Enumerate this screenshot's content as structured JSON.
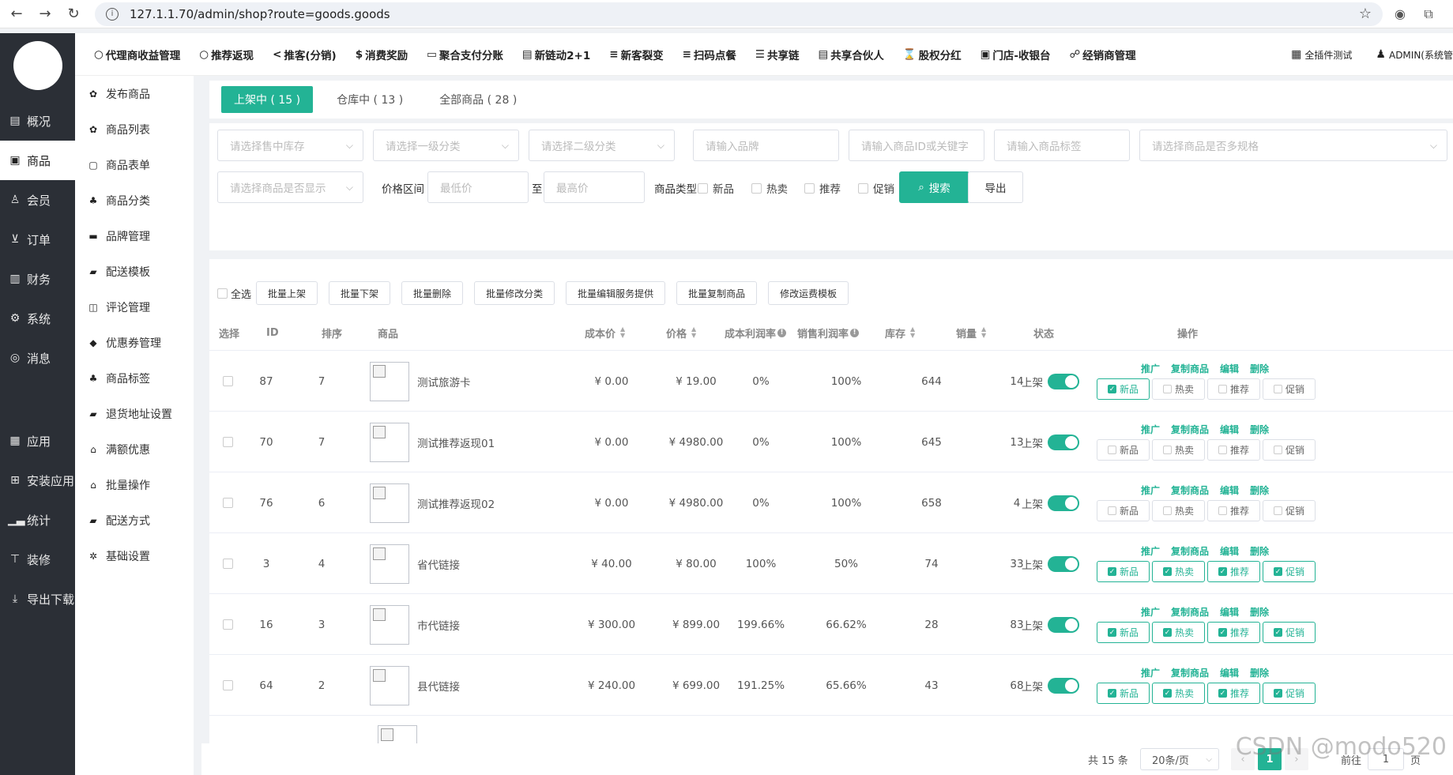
{
  "browser": {
    "url": "127.1.1.70/admin/shop?route=goods.goods"
  },
  "left_nav": [
    {
      "label": "概况",
      "icon": "dashboard-icon",
      "glyph": "▤"
    },
    {
      "label": "商品",
      "icon": "goods-icon",
      "glyph": "▣",
      "active": true
    },
    {
      "label": "会员",
      "icon": "member-icon",
      "glyph": "♙"
    },
    {
      "label": "订单",
      "icon": "cart-icon",
      "glyph": "⊻"
    },
    {
      "label": "财务",
      "icon": "finance-icon",
      "glyph": "▥"
    },
    {
      "label": "系统",
      "icon": "settings-icon",
      "glyph": "⚙"
    },
    {
      "label": "消息",
      "icon": "message-icon",
      "glyph": "◎"
    },
    {
      "label": "应用",
      "icon": "apps-icon",
      "glyph": "▦",
      "gap_before": true
    },
    {
      "label": "安装应用",
      "icon": "install-icon",
      "glyph": "⊞"
    },
    {
      "label": "统计",
      "icon": "stats-icon",
      "glyph": "▁▃"
    },
    {
      "label": "装修",
      "icon": "decorate-icon",
      "glyph": "⊤"
    },
    {
      "label": "导出下载",
      "icon": "download-icon",
      "glyph": "⤓"
    }
  ],
  "top_nav": [
    {
      "label": "代理商收益管理",
      "glyph": "○"
    },
    {
      "label": "推荐返现",
      "glyph": "○"
    },
    {
      "label": "推客(分销)",
      "glyph": "<"
    },
    {
      "label": "消费奖励",
      "glyph": "$"
    },
    {
      "label": "聚合支付分账",
      "glyph": "▭"
    },
    {
      "label": "新链动2+1",
      "glyph": "▤"
    },
    {
      "label": "新客裂变",
      "glyph": "≡"
    },
    {
      "label": "扫码点餐",
      "glyph": "≡"
    },
    {
      "label": "共享链",
      "glyph": "☰"
    },
    {
      "label": "共享合伙人",
      "glyph": "▤"
    },
    {
      "label": "股权分红",
      "glyph": "⌛"
    },
    {
      "label": "门店-收银台",
      "glyph": "▣"
    },
    {
      "label": "经销商管理",
      "glyph": "☍"
    }
  ],
  "top_right": {
    "plugin": "全插件测试",
    "user": "ADMIN(系统管"
  },
  "sub_nav": [
    {
      "label": "发布商品",
      "glyph": "✿"
    },
    {
      "label": "商品列表",
      "glyph": "✿"
    },
    {
      "label": "商品表单",
      "glyph": "▢"
    },
    {
      "label": "商品分类",
      "glyph": "♣"
    },
    {
      "label": "品牌管理",
      "glyph": "▬"
    },
    {
      "label": "配送模板",
      "glyph": "▰"
    },
    {
      "label": "评论管理",
      "glyph": "◫"
    },
    {
      "label": "优惠券管理",
      "glyph": "◆"
    },
    {
      "label": "商品标签",
      "glyph": "♣"
    },
    {
      "label": "退货地址设置",
      "glyph": "▰"
    },
    {
      "label": "满额优惠",
      "glyph": "⌂"
    },
    {
      "label": "批量操作",
      "glyph": "⌂"
    },
    {
      "label": "配送方式",
      "glyph": "▰"
    },
    {
      "label": "基础设置",
      "glyph": "✲"
    }
  ],
  "tabs": [
    {
      "label": "上架中 ( 15 )",
      "active": true
    },
    {
      "label": "仓库中 ( 13 )"
    },
    {
      "label": "全部商品 ( 28 )"
    }
  ],
  "filters": {
    "stock": "请选择售中库存",
    "cat1": "请选择一级分类",
    "cat2": "请选择二级分类",
    "brand": "请输入品牌",
    "keyword": "请输入商品ID或关键字",
    "tag": "请输入商品标签",
    "multi_spec": "请选择商品是否多规格",
    "display": "请选择商品是否显示",
    "price_label": "价格区间",
    "min_price": "最低价",
    "to": "至",
    "max_price": "最高价",
    "type_label": "商品类型",
    "types": [
      "新品",
      "热卖",
      "推荐",
      "促销"
    ],
    "search": "搜索",
    "export": "导出"
  },
  "bulk": {
    "select_all": "全选",
    "buttons": [
      "批量上架",
      "批量下架",
      "批量删除",
      "批量修改分类",
      "批量编辑服务提供",
      "批量复制商品",
      "修改运费模板"
    ]
  },
  "columns": {
    "select": "选择",
    "id": "ID",
    "sort": "排序",
    "goods": "商品",
    "cost": "成本价",
    "price": "价格",
    "cost_margin": "成本利润率",
    "sale_margin": "销售利润率",
    "stock": "库存",
    "sales": "销量",
    "status": "状态",
    "ops": "操作"
  },
  "op_links": [
    "推广",
    "复制商品",
    "编辑",
    "删除"
  ],
  "op_tags": [
    "新品",
    "热卖",
    "推荐",
    "促销"
  ],
  "rows": [
    {
      "id": "87",
      "sort": "7",
      "name": "测试旅游卡",
      "cost": "¥ 0.00",
      "price": "¥ 19.00",
      "cm": "0%",
      "sm": "100%",
      "stock": "644",
      "sales": "14",
      "status": "上架",
      "tags": [
        true,
        false,
        false,
        false
      ]
    },
    {
      "id": "70",
      "sort": "7",
      "name": "测试推荐返现01",
      "cost": "¥ 0.00",
      "price": "¥ 4980.00",
      "cm": "0%",
      "sm": "100%",
      "stock": "645",
      "sales": "13",
      "status": "上架",
      "tags": [
        false,
        false,
        false,
        false
      ]
    },
    {
      "id": "76",
      "sort": "6",
      "name": "测试推荐返现02",
      "cost": "¥ 0.00",
      "price": "¥ 4980.00",
      "cm": "0%",
      "sm": "100%",
      "stock": "658",
      "sales": "4",
      "status": "上架",
      "tags": [
        false,
        false,
        false,
        false
      ]
    },
    {
      "id": "3",
      "sort": "4",
      "name": "省代链接",
      "cost": "¥ 40.00",
      "price": "¥ 80.00",
      "cm": "100%",
      "sm": "50%",
      "stock": "74",
      "sales": "33",
      "status": "上架",
      "tags": [
        true,
        true,
        true,
        true
      ]
    },
    {
      "id": "16",
      "sort": "3",
      "name": "市代链接",
      "cost": "¥ 300.00",
      "price": "¥ 899.00",
      "cm": "199.66%",
      "sm": "66.62%",
      "stock": "28",
      "sales": "83",
      "status": "上架",
      "tags": [
        true,
        true,
        true,
        true
      ]
    },
    {
      "id": "64",
      "sort": "2",
      "name": "县代链接",
      "cost": "¥ 240.00",
      "price": "¥ 699.00",
      "cm": "191.25%",
      "sm": "65.66%",
      "stock": "43",
      "sales": "68",
      "status": "上架",
      "tags": [
        true,
        true,
        true,
        true
      ]
    }
  ],
  "pagination": {
    "total": "共 15 条",
    "page_size": "20条/页",
    "current": "1",
    "goto_label": "前往",
    "goto_value": "1",
    "page_unit": "页"
  },
  "watermark": "CSDN @modo520",
  "accent": "#23b395"
}
